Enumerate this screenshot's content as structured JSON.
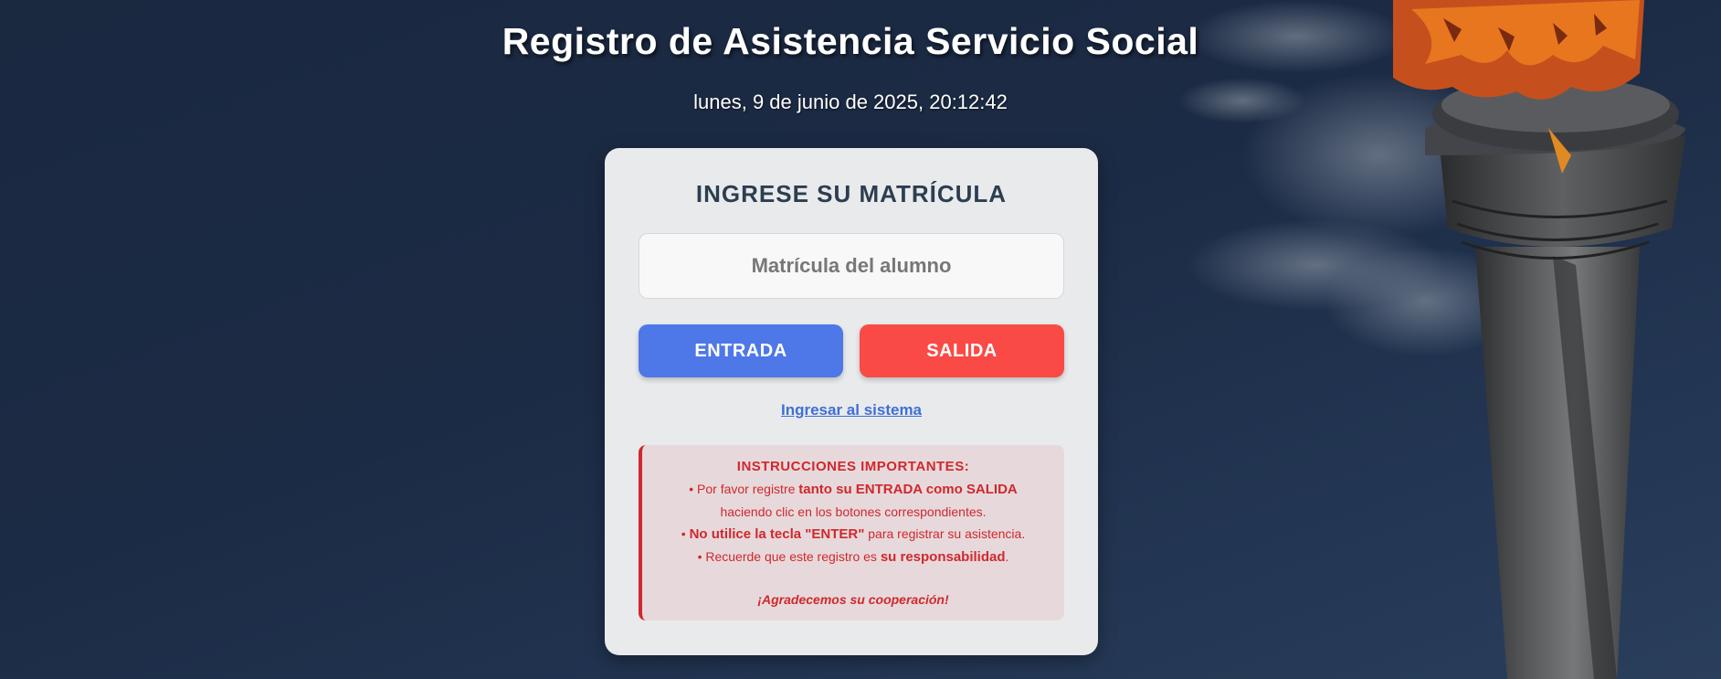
{
  "page": {
    "title": "Registro de Asistencia Servicio Social",
    "datetime": "lunes, 9 de junio de 2025, 20:12:42"
  },
  "card": {
    "heading": "INGRESE SU MATRÍCULA",
    "input_placeholder": "Matrícula del alumno",
    "input_value": "",
    "entrada_label": "ENTRADA",
    "salida_label": "SALIDA",
    "login_link": "Ingresar al sistema"
  },
  "instructions": {
    "title": "INSTRUCCIONES IMPORTANTES:",
    "line1_pre": "• Por favor registre ",
    "line1_bold": "tanto su ENTRADA como SALIDA",
    "line2": "haciendo clic en los botones correspondientes.",
    "line3_pre": "• ",
    "line3_bold": "No utilice la tecla \"ENTER\"",
    "line3_post": " para registrar su asistencia.",
    "line4_pre": "• Recuerde que este registro es ",
    "line4_bold": "su responsabilidad",
    "line4_post": ".",
    "thanks": "¡Agradecemos su cooperación!"
  },
  "colors": {
    "entrada": "#4e78e8",
    "salida": "#fa4a45",
    "notice_text": "#d0282d",
    "link": "#3f6fd6"
  },
  "background": {
    "image": "torch-monument-icon"
  }
}
